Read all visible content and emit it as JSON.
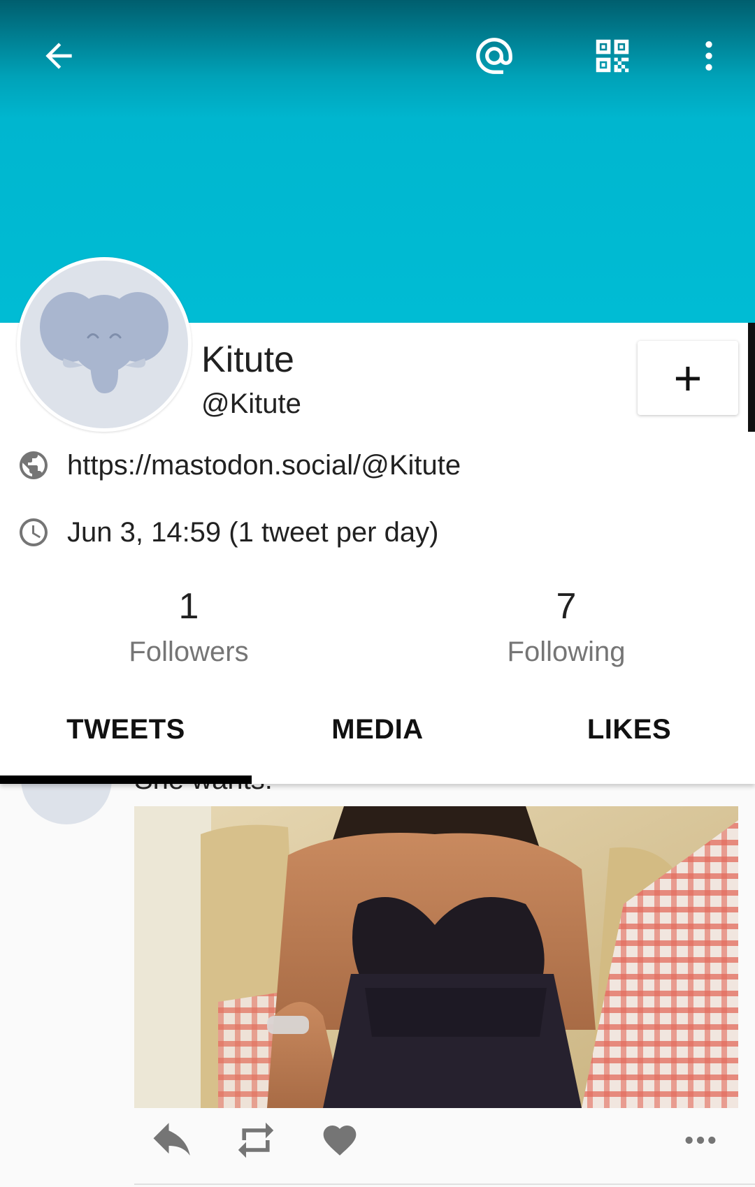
{
  "toolbar": {
    "back_icon": "arrow-left-icon",
    "mention_icon": "at-icon",
    "qr_icon": "qr-code-icon",
    "more_icon": "more-vertical-icon"
  },
  "profile": {
    "name": "Kitute",
    "handle": "@Kitute",
    "url": "https://mastodon.social/@Kitute",
    "joined": "Jun 3, 14:59 (1 tweet per day)",
    "follow_button_label": "+"
  },
  "stats": {
    "followers_count": "1",
    "followers_label": "Followers",
    "following_count": "7",
    "following_label": "Following"
  },
  "tabs": [
    {
      "label": "TWEETS"
    },
    {
      "label": "MEDIA"
    },
    {
      "label": "LIKES"
    }
  ],
  "tweet": {
    "text": "She wants:"
  },
  "colors": {
    "banner": "#00bcd4",
    "banner_top": "#005e6e",
    "avatar_bg": "#dde2ea",
    "elephant": "#a9b6cf",
    "icon_gray": "#757575"
  }
}
